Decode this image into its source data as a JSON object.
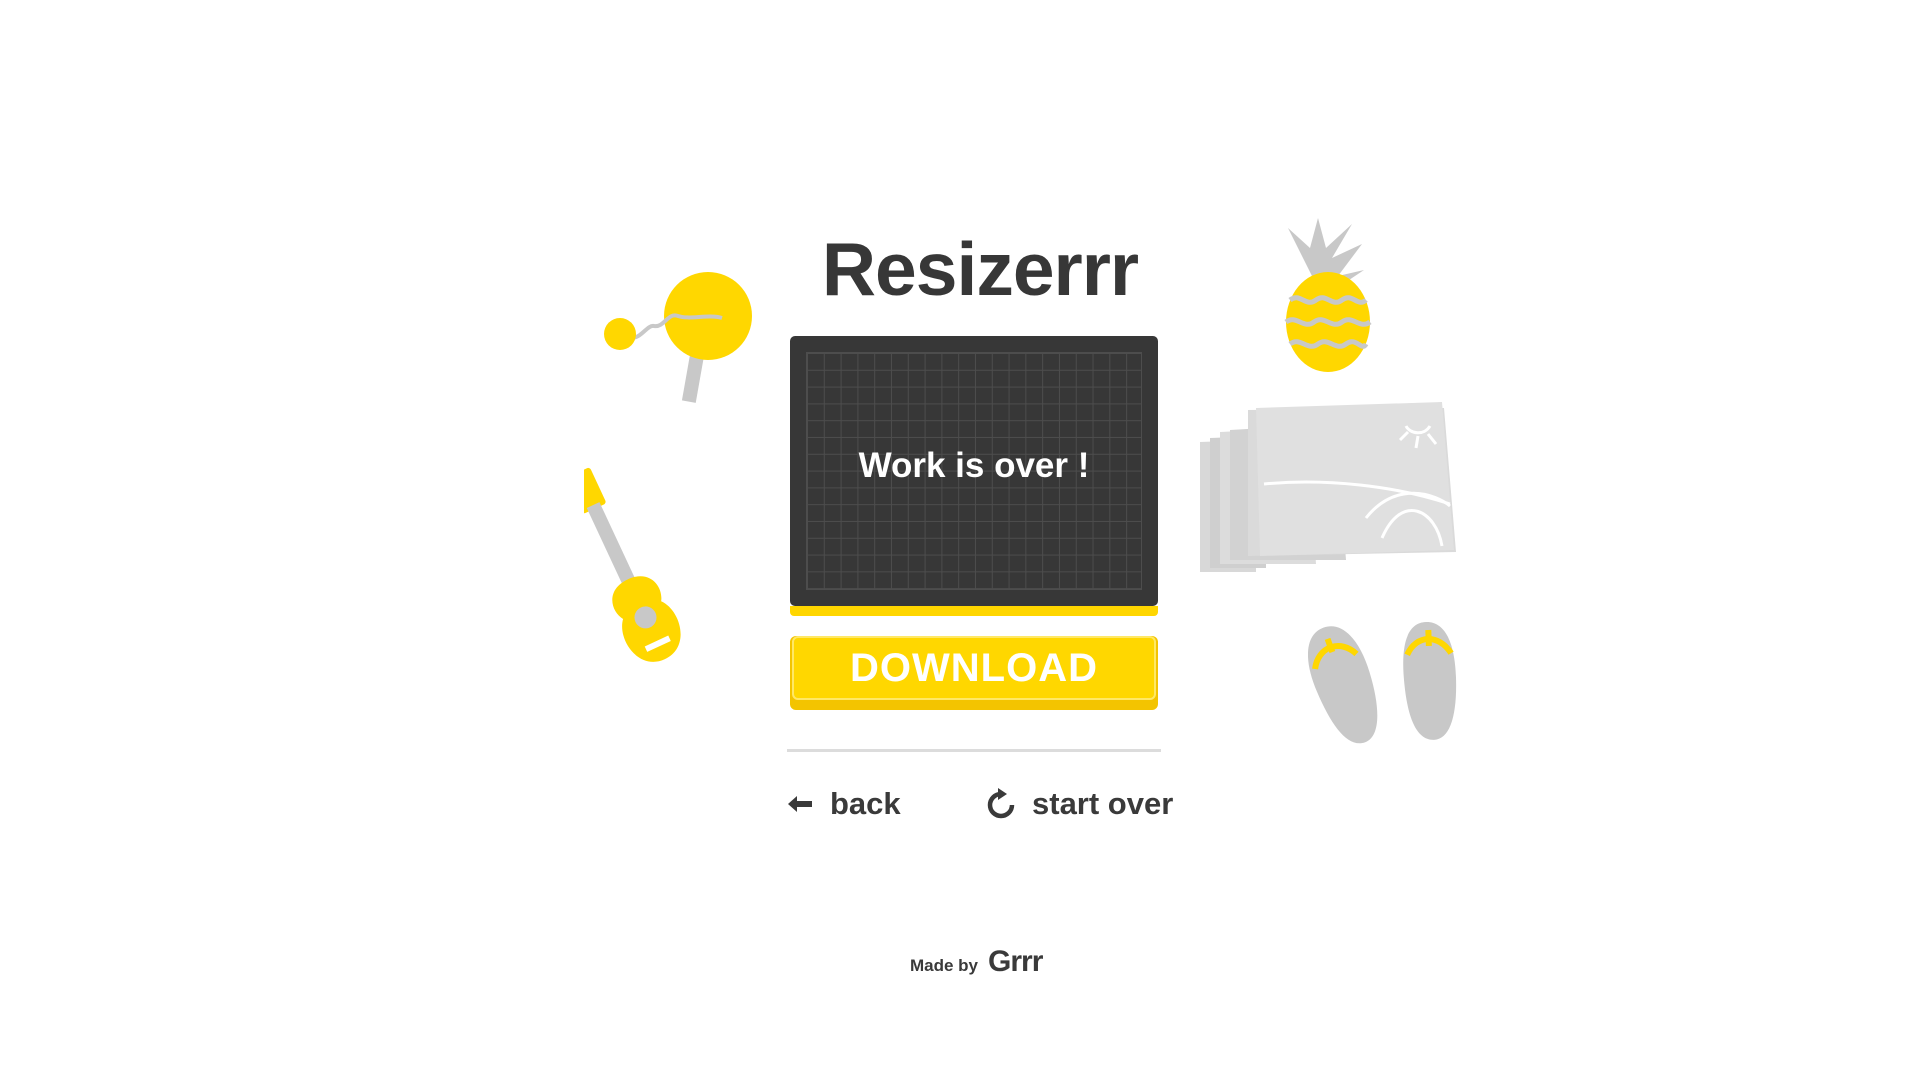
{
  "app": {
    "title": "Resizerrr"
  },
  "board": {
    "message": "Work is over !"
  },
  "actions": {
    "download_label": "DOWNLOAD",
    "back_label": "back",
    "start_over_label": "start over"
  },
  "footer": {
    "made_by": "Made by",
    "brand": "Grrr"
  },
  "icons": {
    "back": "arrow-left-icon",
    "start_over": "refresh-icon"
  },
  "colors": {
    "accent": "#ffd700",
    "dark": "#373737",
    "decor_grey": "#c8c8c8",
    "background": "#ffffff"
  },
  "decorations": [
    "paddle-ball-icon",
    "ukulele-icon",
    "pineapple-icon",
    "postcards-icon",
    "flip-flops-icon"
  ]
}
